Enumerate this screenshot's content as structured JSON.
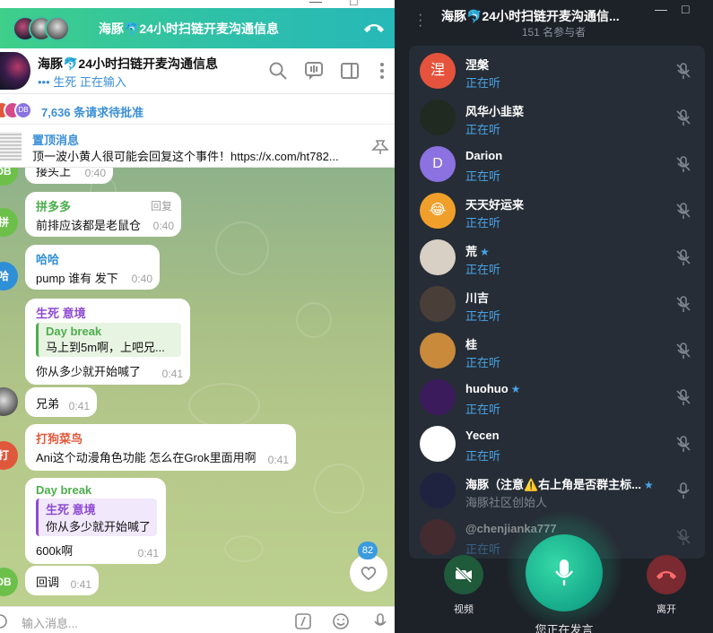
{
  "chat": {
    "call_bar": {
      "title": "海豚🐬24小时扫链开麦沟通信息"
    },
    "header": {
      "name": "海豚🐬24小时扫链开麦沟通信息",
      "status": "••• 生死 正在输入"
    },
    "requests": {
      "text": "7,636 条请求待批准",
      "mini_avatar_label": "DB"
    },
    "pinned": {
      "label": "置顶消息",
      "message": "顶一波小黄人很可能会回复这个事件！https://x.com/ht782..."
    },
    "messages": [
      {
        "avatar": "DB",
        "sender": "",
        "text": "接头上",
        "time": "0:40"
      },
      {
        "avatar": "拼",
        "sender": "拼多多",
        "sender_color": "#4cae4c",
        "text": "前排应该都是老鼠仓",
        "time": "0:40",
        "extra": "回复"
      },
      {
        "avatar": "哈",
        "sender": "哈哈",
        "sender_color": "#2f8fd6",
        "text": "pump 谁有 发下",
        "time": "0:40"
      },
      {
        "avatar": "",
        "sender": "生死 意境",
        "sender_color": "#8e4bd2",
        "reply_sender": "Day break",
        "reply_text": "马上到5m啊，上吧兄...",
        "text": "你从多少就开始喊了",
        "time": "0:41"
      },
      {
        "avatar": "",
        "sender": "",
        "text": "兄弟",
        "time": "0:41"
      },
      {
        "avatar": "打",
        "sender": "打狗菜鸟",
        "sender_color": "#e0583c",
        "text": "Ani这个动漫角色功能 怎么在Grok里面用啊",
        "time": "0:41"
      },
      {
        "avatar": "",
        "sender": "Day break",
        "sender_color": "#4cae4c",
        "reply_sender": "生死 意境",
        "reply_text": "你从多少就开始喊了",
        "text": "600k啊",
        "time": "0:41"
      },
      {
        "avatar": "DB",
        "sender": "",
        "text": "回调",
        "time": "0:41"
      }
    ],
    "unread_badge": "82",
    "input": {
      "placeholder": "输入消息..."
    }
  },
  "voice": {
    "title": "海豚🐬24小时扫链开麦沟通信...",
    "subtitle": "151 名参与者",
    "participants": [
      {
        "name": "涅槃",
        "status": "正在听",
        "avatar": "涅",
        "color": "#e5533c",
        "star": false
      },
      {
        "name": "风华小韭菜",
        "status": "正在听",
        "avatar": "",
        "color": "#202a20",
        "star": false
      },
      {
        "name": "Darion",
        "status": "正在听",
        "avatar": "D",
        "color": "#8b72e0",
        "star": false
      },
      {
        "name": "天天好运来",
        "status": "正在听",
        "avatar": "😂",
        "color": "#f0a02a",
        "star": false
      },
      {
        "name": "荒",
        "status": "正在听",
        "avatar": "",
        "color": "#d8d0c4",
        "star": true
      },
      {
        "name": "川吉",
        "status": "正在听",
        "avatar": "",
        "color": "#4a3f38",
        "star": false
      },
      {
        "name": "桂",
        "status": "正在听",
        "avatar": "",
        "color": "#c98a3c",
        "star": false
      },
      {
        "name": "huohuo",
        "status": "正在听",
        "avatar": "",
        "color": "#3b1b5c",
        "star": true
      },
      {
        "name": "Yecen",
        "status": "正在听",
        "avatar": "",
        "color": "#ffffff",
        "star": false
      },
      {
        "name": "海豚（注意⚠️右上角是否群主标...",
        "status": "海豚社区创始人",
        "avatar": "",
        "color": "#1f2340",
        "star": true
      },
      {
        "name": "@chenjianka777",
        "status": "正在听",
        "avatar": "",
        "color": "#6a2a2a",
        "star": false
      }
    ],
    "controls": {
      "video_label": "视频",
      "leave_label": "离开",
      "speaking_label": "您正在发言"
    },
    "colors": {
      "accent": "#4aa3e6",
      "mic_green": "#1fc78f",
      "leave_red": "#c4373f"
    }
  }
}
